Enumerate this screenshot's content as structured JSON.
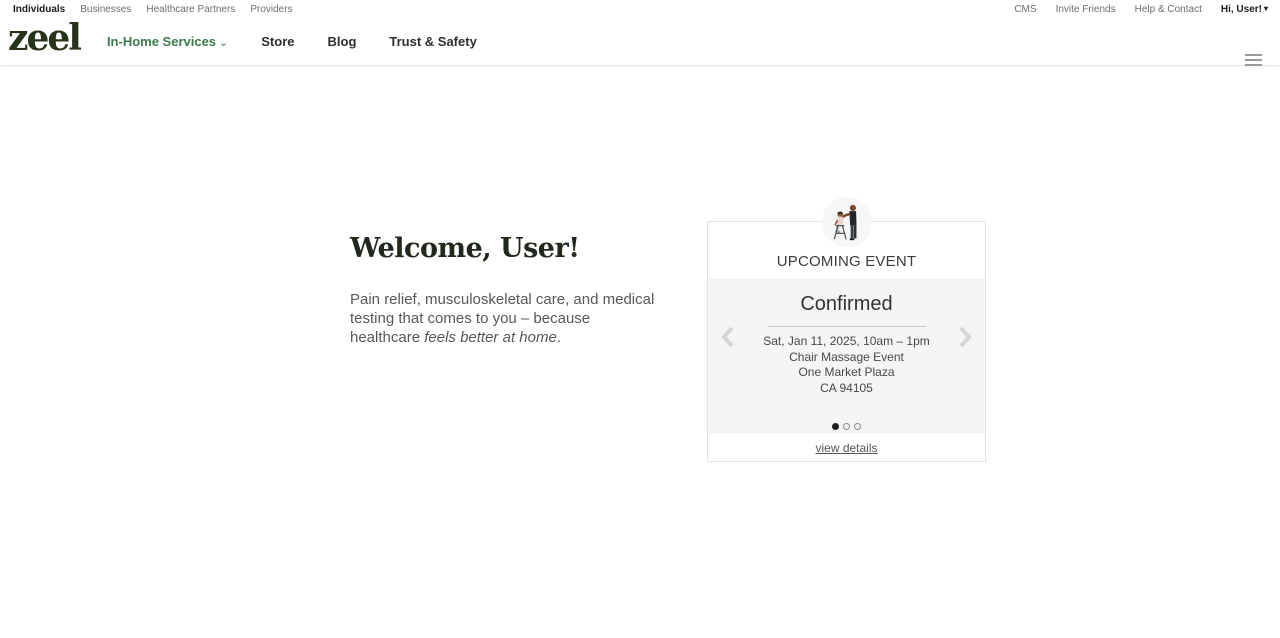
{
  "topbar": {
    "left_links": [
      {
        "label": "Individuals",
        "active": true
      },
      {
        "label": "Businesses",
        "active": false
      },
      {
        "label": "Healthcare Partners",
        "active": false
      },
      {
        "label": "Providers",
        "active": false
      }
    ],
    "right_links": [
      {
        "label": "CMS"
      },
      {
        "label": "Invite Friends"
      },
      {
        "label": "Help & Contact"
      }
    ],
    "user_menu_label": "Hi, User!",
    "user_menu_caret": "▾"
  },
  "nav": {
    "logo_text": "zeel",
    "items": [
      {
        "label": "In-Home Services",
        "caret": "⌄"
      },
      {
        "label": "Store"
      },
      {
        "label": "Blog"
      },
      {
        "label": "Trust & Safety"
      }
    ]
  },
  "main": {
    "welcome_title": "Welcome, User!",
    "intro_before": "Pain relief, musculoskeletal care, and medical testing that comes to you – because healthcare ",
    "intro_italic": "feels better at home",
    "intro_after": "."
  },
  "event_card": {
    "icon": "chair-massage-illustration",
    "header": "UPCOMING EVENT",
    "status": "Confirmed",
    "datetime": "Sat, Jan 11, 2025, 10am – 1pm",
    "event_name": "Chair Massage Event",
    "address_line1": "One Market Plaza",
    "address_line2": "CA 94105",
    "view_details_label": "view details",
    "carousel": {
      "total": 3,
      "active_index": 0
    }
  },
  "colors": {
    "brand_green": "#3e7a4e",
    "logo_dark_green": "#263319",
    "card_body_gray": "#f5f5f5",
    "card_border": "#e2e2e2",
    "active_dot": "#1c1c1c"
  }
}
